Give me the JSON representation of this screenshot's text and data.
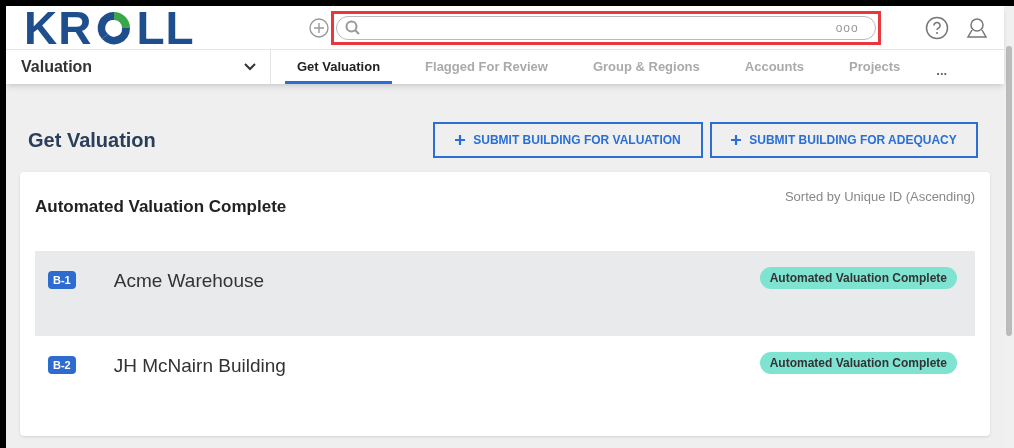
{
  "logo": {
    "left": "KR",
    "right": "LL"
  },
  "search": {
    "options_icon": "ooo"
  },
  "module": {
    "label": "Valuation"
  },
  "tabs": [
    {
      "label": "Get Valuation",
      "selected": true
    },
    {
      "label": "Flagged For Review",
      "selected": false
    },
    {
      "label": "Group & Regions",
      "selected": false
    },
    {
      "label": "Accounts",
      "selected": false
    },
    {
      "label": "Projects",
      "selected": false
    }
  ],
  "more": "...",
  "page_title": "Get Valuation",
  "buttons": [
    "SUBMIT BUILDING FOR VALUATION",
    "SUBMIT BUILDING FOR ADEQUACY"
  ],
  "card": {
    "title": "Automated Valuation Complete",
    "sort": "Sorted by Unique ID (Ascending)"
  },
  "rows": [
    {
      "id": "B-1",
      "name": "Acme Warehouse",
      "status": "Automated Valuation Complete",
      "selected": true
    },
    {
      "id": "B-2",
      "name": "JH McNairn Building",
      "status": "Automated Valuation Complete",
      "selected": false
    }
  ]
}
